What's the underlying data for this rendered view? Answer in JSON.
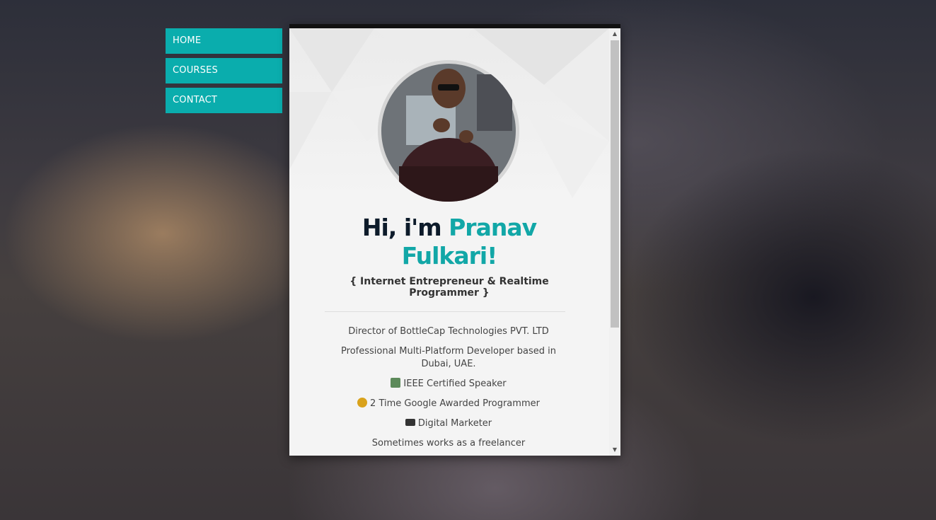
{
  "nav": {
    "items": [
      "HOME",
      "COURSES",
      "CONTACT"
    ]
  },
  "profile": {
    "greeting": "Hi, i'm ",
    "name_line1": "Pranav",
    "name_line2": "Fulkari!",
    "tagline": "{ Internet Entrepreneur & Realtime Programmer }"
  },
  "info": {
    "line1": "Director of BottleCap Technologies PVT. LTD",
    "line2": "Professional Multi-Platform Developer based in Dubai, UAE.",
    "line3": "IEEE Certified Speaker",
    "line4": "2 Time Google Awarded Programmer",
    "line5": "Digital Marketer",
    "line6": "Sometimes works as a freelancer"
  },
  "icons": {
    "speaker": "speaker-icon",
    "medal": "medal-icon",
    "laptop": "laptop-icon"
  },
  "colors": {
    "accent": "#0aadad",
    "name": "#12a7a7",
    "heading": "#0d1b2a"
  }
}
